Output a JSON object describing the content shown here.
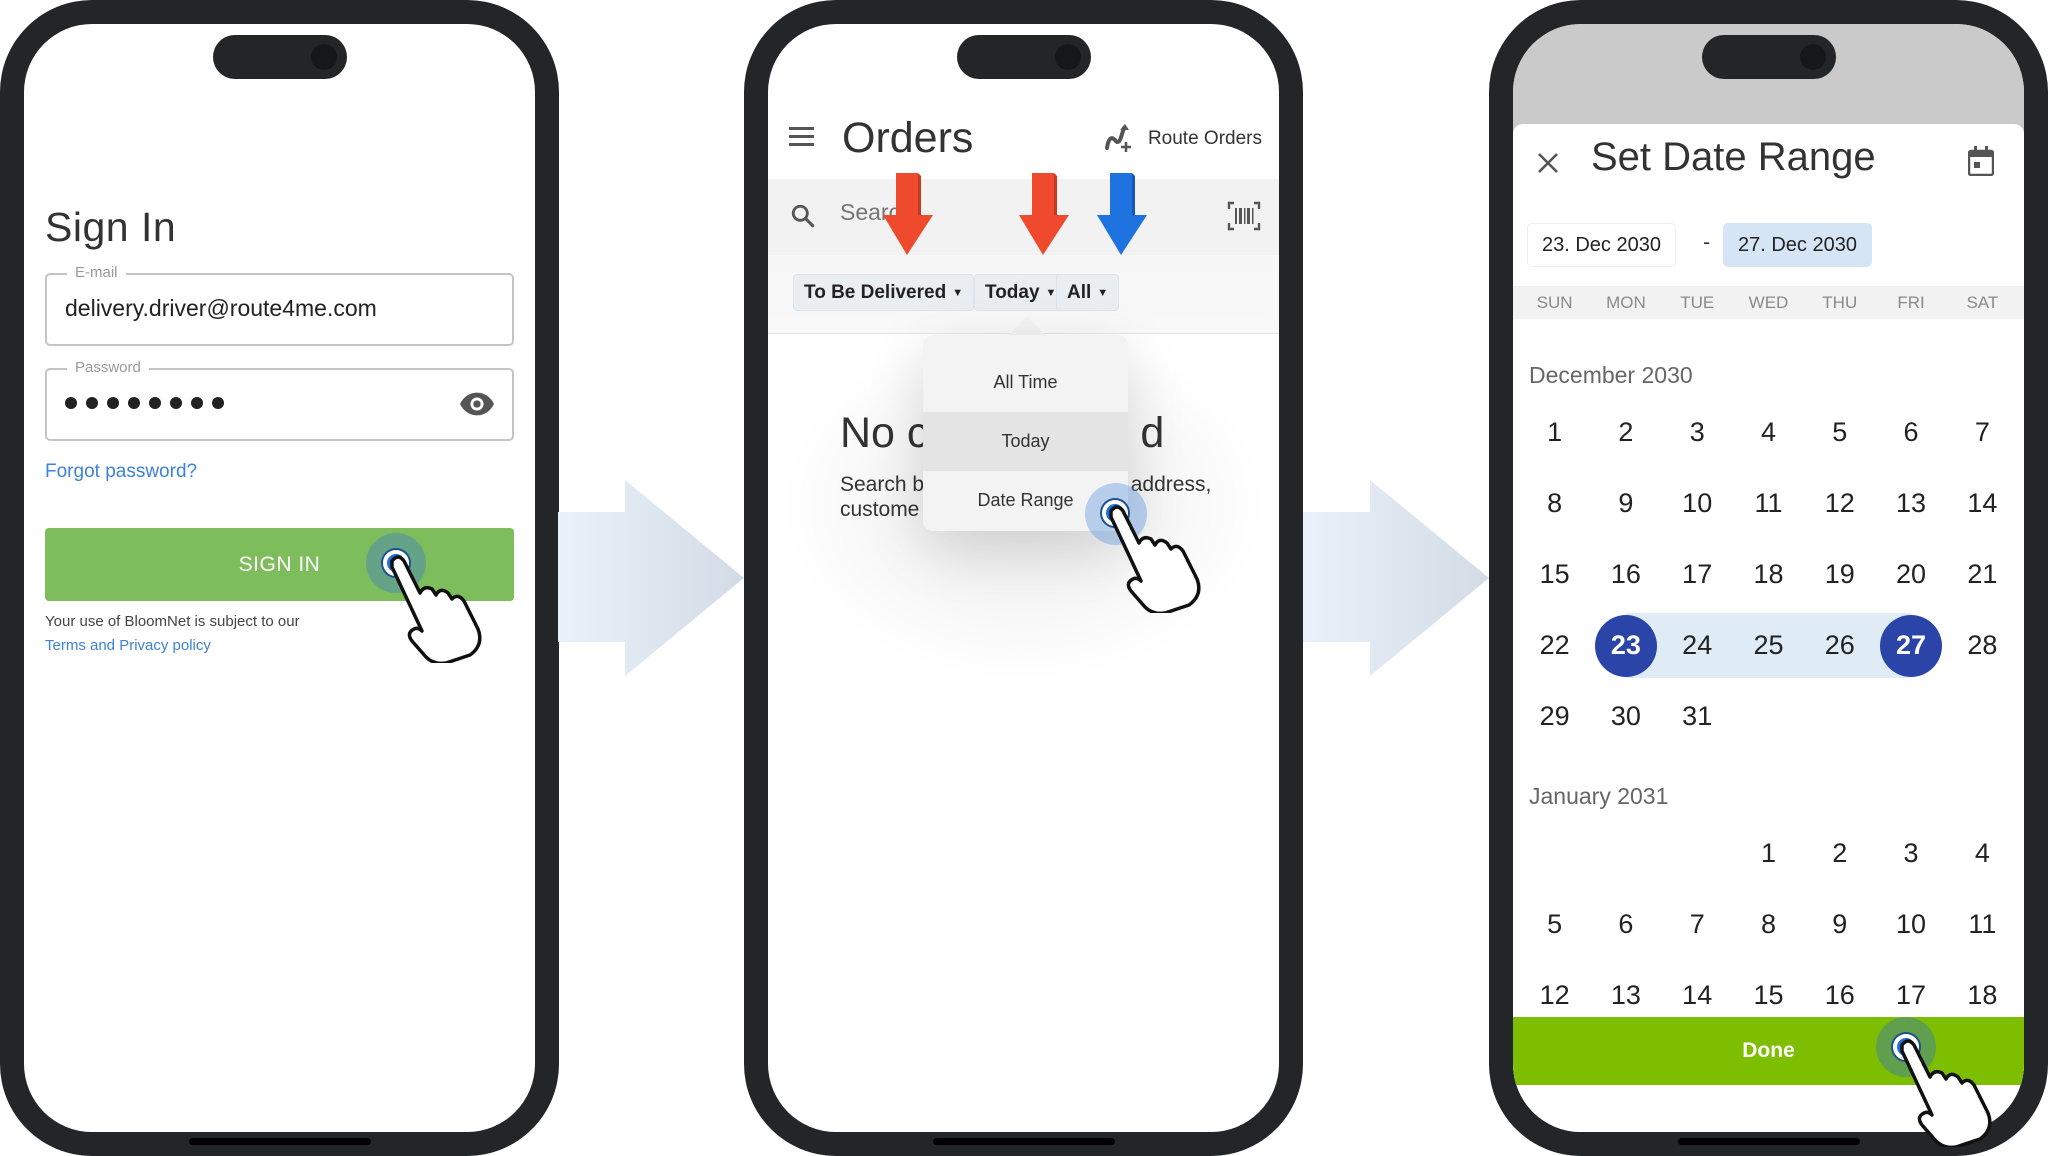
{
  "colors": {
    "phone_frame": "#222629",
    "signin_green": "#7dbd5b",
    "done_green": "#7dbf00",
    "link_blue": "#3d82d6",
    "annotation_red": "#ef4a2d",
    "annotation_blue": "#1e73e0",
    "range_selected": "#2b44a8",
    "range_fill": "#dfebf5"
  },
  "signin": {
    "title": "Sign In",
    "email_label": "E-mail",
    "email_value": "delivery.driver@route4me.com",
    "password_label": "Password",
    "password_mask_count": 8,
    "show_password_icon": "eye-icon",
    "forgot_password": "Forgot password?",
    "signin_button": "SIGN IN",
    "terms_text": "Your use of BloomNet is subject to our",
    "terms_link": "Terms and Privacy policy"
  },
  "orders": {
    "menu_icon": "hamburger-icon",
    "title": "Orders",
    "route_orders_icon": "route-plus-icon",
    "route_orders": "Route Orders",
    "search_placeholder": "Search",
    "barcode_icon": "barcode-icon",
    "filters": [
      {
        "label": "To Be Delivered",
        "annotation": "red"
      },
      {
        "label": "Today",
        "annotation": "red"
      },
      {
        "label": "All",
        "annotation": "blue"
      }
    ],
    "dropdown_options": [
      {
        "label": "All Time",
        "active": false
      },
      {
        "label": "Today",
        "active": true
      },
      {
        "label": "Date Range",
        "active": false
      }
    ],
    "empty_title_left": "No c",
    "empty_title_right": "d",
    "empty_desc_line1_left": "Search b",
    "empty_desc_line1_right": ", address,",
    "empty_desc_line2_left": "custome"
  },
  "date_range": {
    "title": "Set Date Range",
    "close_icon": "close-icon",
    "calendar_icon": "calendar-icon",
    "start_date": "23. Dec 2030",
    "separator": "-",
    "end_date": "27. Dec 2030",
    "weekdays": [
      "SUN",
      "MON",
      "TUE",
      "WED",
      "THU",
      "FRI",
      "SAT"
    ],
    "months": [
      {
        "label": "December 2030",
        "first_weekday_index": 0,
        "days": [
          1,
          2,
          3,
          4,
          5,
          6,
          7,
          8,
          9,
          10,
          11,
          12,
          13,
          14,
          15,
          16,
          17,
          18,
          19,
          20,
          21,
          22,
          23,
          24,
          25,
          26,
          27,
          28,
          29,
          30,
          31
        ]
      },
      {
        "label": "January 2031",
        "first_weekday_index": 3,
        "days": [
          1,
          2,
          3,
          4,
          5,
          6,
          7,
          8,
          9,
          10,
          11,
          12,
          13,
          14,
          15,
          16,
          17,
          18
        ]
      }
    ],
    "range_start_day": 23,
    "range_end_day": 27,
    "done_button": "Done"
  }
}
